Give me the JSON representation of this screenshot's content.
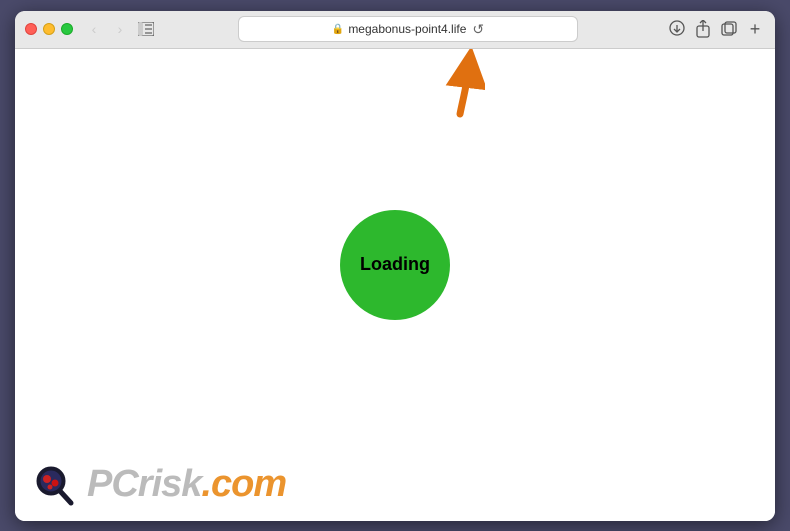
{
  "browser": {
    "url": "megabonus-point4.life",
    "url_display": "megabonus-point4.life"
  },
  "traffic_lights": {
    "close_title": "Close",
    "minimize_title": "Minimize",
    "maximize_title": "Maximize"
  },
  "page": {
    "loading_text": "Loading",
    "background_color": "#ffffff",
    "circle_color": "#2db82d"
  },
  "watermark": {
    "text_pc": "PC",
    "text_risk": "risk",
    "text_dotcom": ".com"
  },
  "toolbar": {
    "back_icon": "‹",
    "forward_icon": "›",
    "reload_icon": "↺",
    "download_icon": "↓",
    "share_icon": "↑",
    "tabs_icon": "⧉",
    "add_tab": "+"
  }
}
